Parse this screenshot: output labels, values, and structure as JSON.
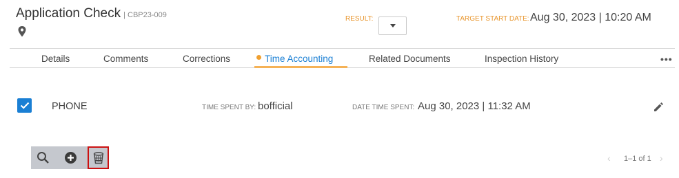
{
  "header": {
    "title": "Application Check",
    "case_number": "| CBP23-009",
    "result_label": "RESULT:",
    "target_label": "TARGET START DATE:",
    "target_value": "Aug 30, 2023 | 10:20 AM"
  },
  "tabs": [
    {
      "label": "Details",
      "active": false
    },
    {
      "label": "Comments",
      "active": false
    },
    {
      "label": "Corrections",
      "active": false
    },
    {
      "label": "Time Accounting",
      "active": true
    },
    {
      "label": "Related Documents",
      "active": false
    },
    {
      "label": "Inspection History",
      "active": false
    }
  ],
  "more_label": "•••",
  "record": {
    "checked": true,
    "type": "PHONE",
    "time_spent_by_label": "TIME SPENT BY:",
    "time_spent_by": "bofficial",
    "date_time_label": "DATE TIME SPENT:",
    "date_time": "Aug 30, 2023 | 11:32 AM"
  },
  "pager": {
    "prev": "‹",
    "text": "1–1 of 1",
    "next": "›"
  },
  "colors": {
    "accent_orange": "#e8962e",
    "active_tab": "#1a7fd4",
    "checkbox": "#1a7fd4",
    "delete_highlight": "#cc1111"
  }
}
